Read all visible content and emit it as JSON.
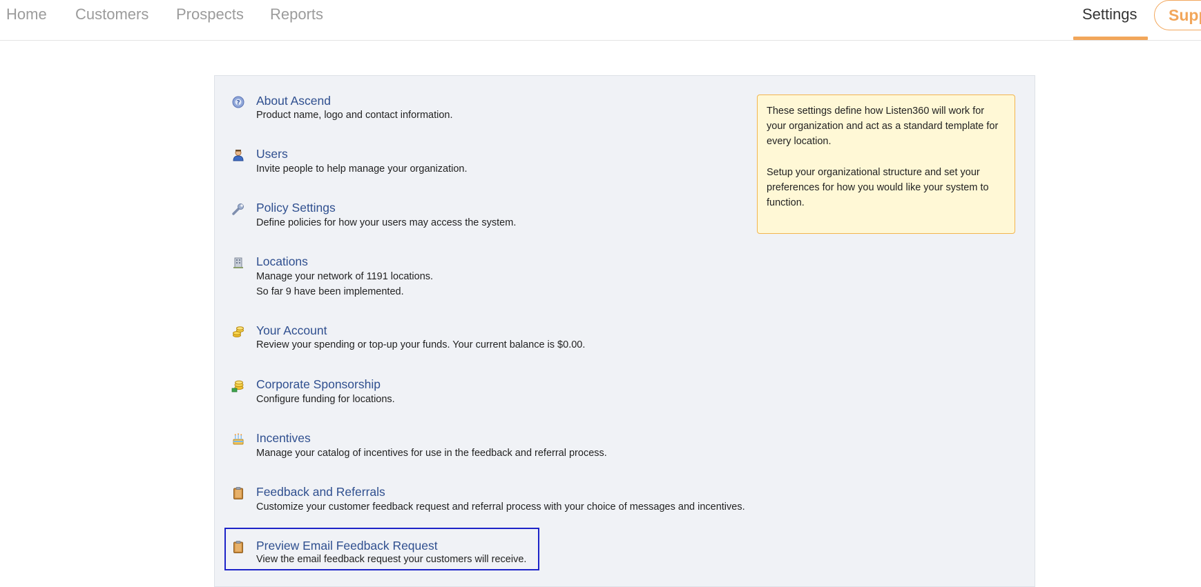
{
  "nav": {
    "home": "Home",
    "customers": "Customers",
    "prospects": "Prospects",
    "reports": "Reports",
    "settings": "Settings",
    "support": "Supp"
  },
  "colors": {
    "accent": "#f2a65a",
    "link": "#2f4f8f",
    "panel_bg": "#f0f2f6",
    "info_bg": "#fff8d6",
    "highlight_border": "#1c23c8"
  },
  "settings_items": [
    {
      "icon": "help-icon",
      "title": "About Ascend",
      "desc": [
        "Product name, logo and contact information."
      ]
    },
    {
      "icon": "user-icon",
      "title": "Users",
      "desc": [
        "Invite people to help manage your organization."
      ]
    },
    {
      "icon": "wrench-icon",
      "title": "Policy Settings",
      "desc": [
        "Define policies for how your users may access the system."
      ]
    },
    {
      "icon": "building-icon",
      "title": "Locations",
      "desc": [
        "Manage your network of 1191 locations.",
        "So far 9 have been implemented."
      ]
    },
    {
      "icon": "coins-icon",
      "title": "Your Account",
      "desc": [
        "Review your spending or top-up your funds. Your current balance is $0.00."
      ]
    },
    {
      "icon": "coins-add-icon",
      "title": "Corporate Sponsorship",
      "desc": [
        "Configure funding for locations."
      ]
    },
    {
      "icon": "cake-icon",
      "title": "Incentives",
      "desc": [
        "Manage your catalog of incentives for use in the feedback and referral process."
      ]
    },
    {
      "icon": "clipboard-icon",
      "title": "Feedback and Referrals",
      "desc": [
        "Customize your customer feedback request and referral process with your choice of messages and incentives."
      ]
    },
    {
      "icon": "clipboard-icon",
      "title": "Preview Email Feedback Request",
      "desc": [
        "View the email feedback request your customers will receive."
      ]
    }
  ],
  "info": {
    "paragraph1": "These settings define how Listen360 will work for your organization and act as a standard template for every location.",
    "paragraph2": "Setup your organizational structure and set your preferences for how you would like your system to function."
  }
}
